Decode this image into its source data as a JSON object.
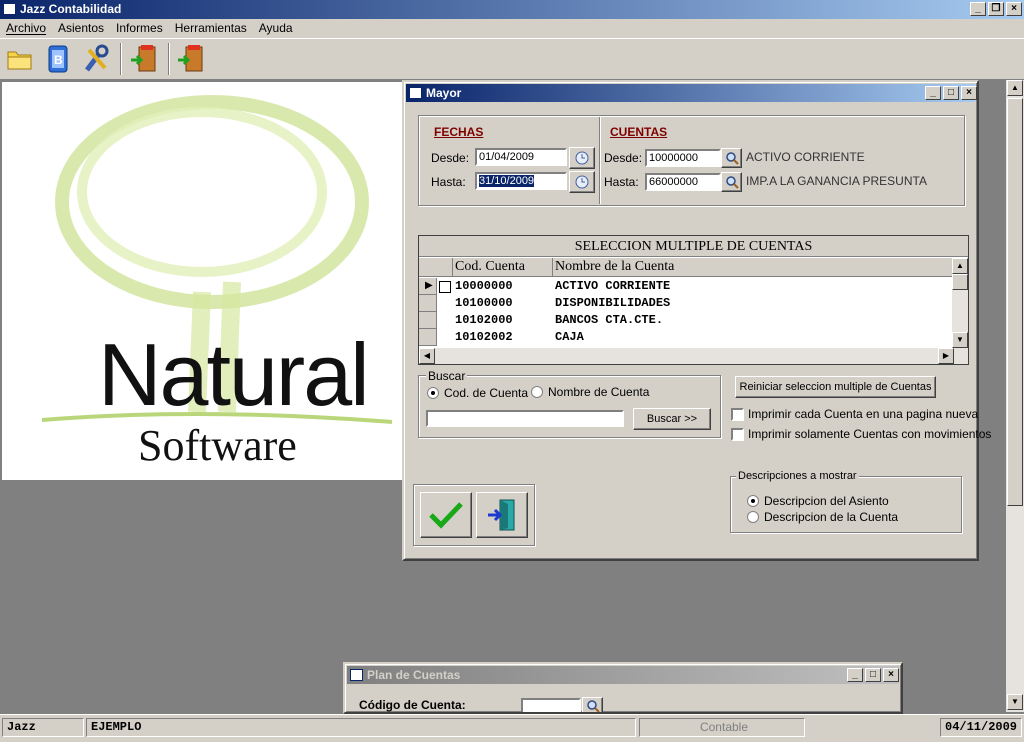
{
  "app": {
    "title": "Jazz Contabilidad",
    "window_buttons": [
      "_",
      "❐",
      "×"
    ]
  },
  "menu": [
    "Archivo",
    "Asientos",
    "Informes",
    "Herramientas",
    "Ayuda"
  ],
  "toolbar": {
    "icons": [
      "folder-icon",
      "database-icon",
      "tools-icon",
      "exit-door-icon",
      "exit-door-icon"
    ]
  },
  "logo": {
    "brand": "Natural",
    "sub": "Software"
  },
  "mayor": {
    "title": "Mayor",
    "fechas": {
      "header": "FECHAS",
      "desde_label": "Desde:",
      "desde_value": "01/04/2009",
      "hasta_label": "Hasta:",
      "hasta_value": "31/10/2009"
    },
    "cuentas": {
      "header": "CUENTAS",
      "desde_label": "Desde:",
      "desde_value": "10000000",
      "desde_name": "ACTIVO CORRIENTE",
      "hasta_label": "Hasta:",
      "hasta_value": "66000000",
      "hasta_name": "IMP.A LA GANANCIA PRESUNTA"
    },
    "grid": {
      "caption": "SELECCION MULTIPLE DE CUENTAS",
      "columns": [
        "Cod. Cuenta",
        "Nombre de la Cuenta"
      ],
      "rows": [
        {
          "code": "10000000",
          "name": "ACTIVO CORRIENTE"
        },
        {
          "code": "10100000",
          "name": "DISPONIBILIDADES"
        },
        {
          "code": "10102000",
          "name": "BANCOS CTA.CTE."
        },
        {
          "code": "10102002",
          "name": "CAJA"
        }
      ]
    },
    "buscar": {
      "legend": "Buscar",
      "opt_code": "Cod. de Cuenta",
      "opt_name": "Nombre de Cuenta",
      "selected": "Cod. de Cuenta",
      "value": "",
      "button": "Buscar >>"
    },
    "reset_button": "Reiniciar seleccion multiple de Cuentas",
    "check_new_page": "Imprimir cada Cuenta en una pagina nueva",
    "check_only_moves": "Imprimir solamente Cuentas con movimientos",
    "descripciones": {
      "legend": "Descripciones a mostrar",
      "opt_asiento": "Descripcion del Asiento",
      "opt_cuenta": "Descripcion de la Cuenta",
      "selected": "Descripcion del Asiento"
    }
  },
  "plan": {
    "title": "Plan de Cuentas",
    "code_label": "Código de Cuenta:",
    "code_value": ""
  },
  "status": {
    "user": "Jazz",
    "company": "EJEMPLO",
    "module": "Contable",
    "date": "04/11/2009"
  },
  "colors": {
    "title_active": "#0a246a",
    "face": "#d4d0c8",
    "header_red": "#800000",
    "workspace": "#808080"
  }
}
